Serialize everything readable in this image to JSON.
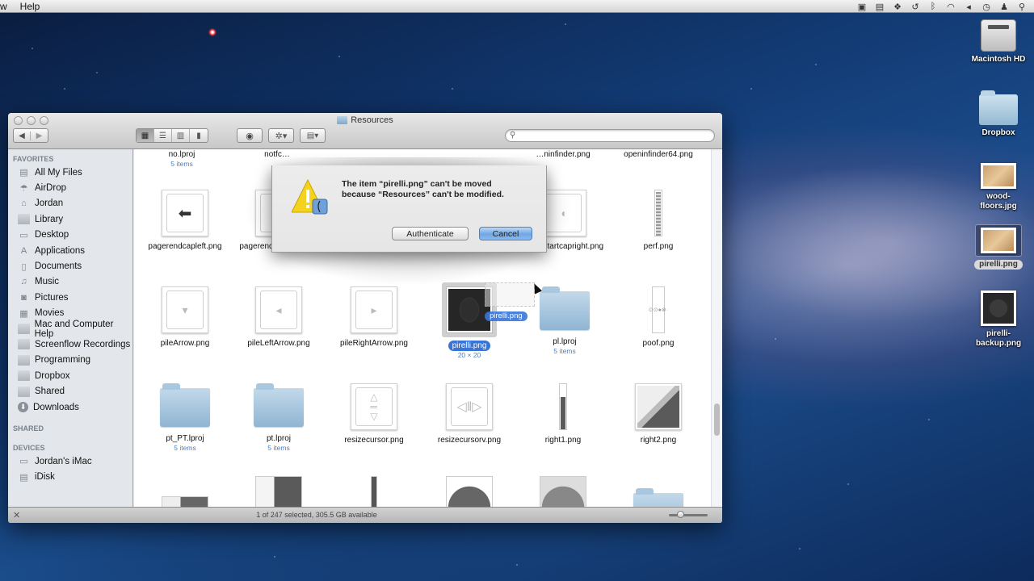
{
  "menubar": {
    "items": [
      "w",
      "Help"
    ],
    "status_icons": [
      "screen-icon",
      "camera-icon",
      "dropbox-icon",
      "time-machine-icon",
      "bluetooth-icon",
      "wifi-icon",
      "volume-icon",
      "clock-icon",
      "user-icon",
      "spotlight-icon"
    ]
  },
  "desktop": {
    "icons": [
      {
        "label": "Macintosh HD",
        "icon": "hard-drive-icon"
      },
      {
        "label": "Dropbox",
        "icon": "dropbox-folder-icon"
      },
      {
        "label": "wood-floors.jpg",
        "icon": "image-thumbnail"
      },
      {
        "label": "pirelli.png",
        "icon": "image-thumbnail",
        "selected": true
      },
      {
        "label": "pirelli-backup.png",
        "icon": "image-thumbnail"
      }
    ]
  },
  "finder": {
    "title": "Resources",
    "toolbar": {
      "back": "◀",
      "forward": "▶",
      "view_modes": [
        "icon-view",
        "list-view",
        "column-view",
        "coverflow-view"
      ],
      "active_view": "icon-view",
      "quicklook": "eye-icon",
      "action": "gear-icon",
      "arrange": "arrange-icon",
      "search_placeholder": ""
    },
    "sidebar": {
      "favorites_header": "FAVORITES",
      "favorites": [
        {
          "label": "All My Files",
          "icon": "all-files-icon"
        },
        {
          "label": "AirDrop",
          "icon": "airdrop-icon"
        },
        {
          "label": "Jordan",
          "icon": "home-icon"
        },
        {
          "label": "Library",
          "icon": "folder-icon"
        },
        {
          "label": "Desktop",
          "icon": "desktop-icon"
        },
        {
          "label": "Applications",
          "icon": "applications-icon"
        },
        {
          "label": "Documents",
          "icon": "documents-icon"
        },
        {
          "label": "Music",
          "icon": "music-icon"
        },
        {
          "label": "Pictures",
          "icon": "pictures-icon"
        },
        {
          "label": "Movies",
          "icon": "movies-icon"
        },
        {
          "label": "Mac and Computer Help",
          "icon": "folder-icon"
        },
        {
          "label": "Screenflow Recordings",
          "icon": "folder-icon"
        },
        {
          "label": "Programming",
          "icon": "folder-icon"
        },
        {
          "label": "Dropbox",
          "icon": "folder-icon"
        },
        {
          "label": "Shared",
          "icon": "folder-icon"
        },
        {
          "label": "Downloads",
          "icon": "downloads-icon"
        }
      ],
      "shared_header": "SHARED",
      "devices_header": "DEVICES",
      "devices": [
        {
          "label": "Jordan's iMac",
          "icon": "imac-icon"
        },
        {
          "label": "iDisk",
          "icon": "idisk-icon"
        }
      ]
    },
    "files": {
      "row0": [
        {
          "name": "no.lproj",
          "sub": "5 items"
        },
        {
          "name": "notfc…",
          "sub": ""
        },
        {
          "name": "",
          "sub": ""
        },
        {
          "name": "",
          "sub": ""
        },
        {
          "name": "…ninfinder.png",
          "sub": ""
        },
        {
          "name": "openinfinder64.png",
          "sub": ""
        }
      ],
      "row1": [
        {
          "name": "pagerendcapleft.png",
          "sub": ""
        },
        {
          "name": "pagerendcapright.png",
          "sub": ""
        },
        {
          "name": "",
          "sub": ""
        },
        {
          "name": "",
          "sub": ""
        },
        {
          "name": "pagerstartcapright.png",
          "sub": ""
        },
        {
          "name": "perf.png",
          "sub": ""
        }
      ],
      "row2": [
        {
          "name": "pileArrow.png",
          "sub": ""
        },
        {
          "name": "pileLeftArrow.png",
          "sub": ""
        },
        {
          "name": "pileRightArrow.png",
          "sub": ""
        },
        {
          "name": "pirelli.png",
          "sub": "20 × 20",
          "selected": true
        },
        {
          "name": "pl.lproj",
          "sub": "5 items"
        },
        {
          "name": "poof.png",
          "sub": ""
        }
      ],
      "row3": [
        {
          "name": "pt_PT.lproj",
          "sub": "5 items"
        },
        {
          "name": "pt.lproj",
          "sub": "5 items"
        },
        {
          "name": "resizecursor.png",
          "sub": ""
        },
        {
          "name": "resizecursorv.png",
          "sub": ""
        },
        {
          "name": "right1.png",
          "sub": ""
        },
        {
          "name": "right2.png",
          "sub": ""
        }
      ]
    },
    "drag_label": "pirelli.png",
    "status": "1 of 247 selected, 305.5 GB available",
    "icon_size_slider": 0.25
  },
  "dialog": {
    "message_line1": "The item “pirelli.png” can't be moved",
    "message_line2": "because “Resources” can't be modified.",
    "authenticate_label": "Authenticate",
    "cancel_label": "Cancel"
  }
}
